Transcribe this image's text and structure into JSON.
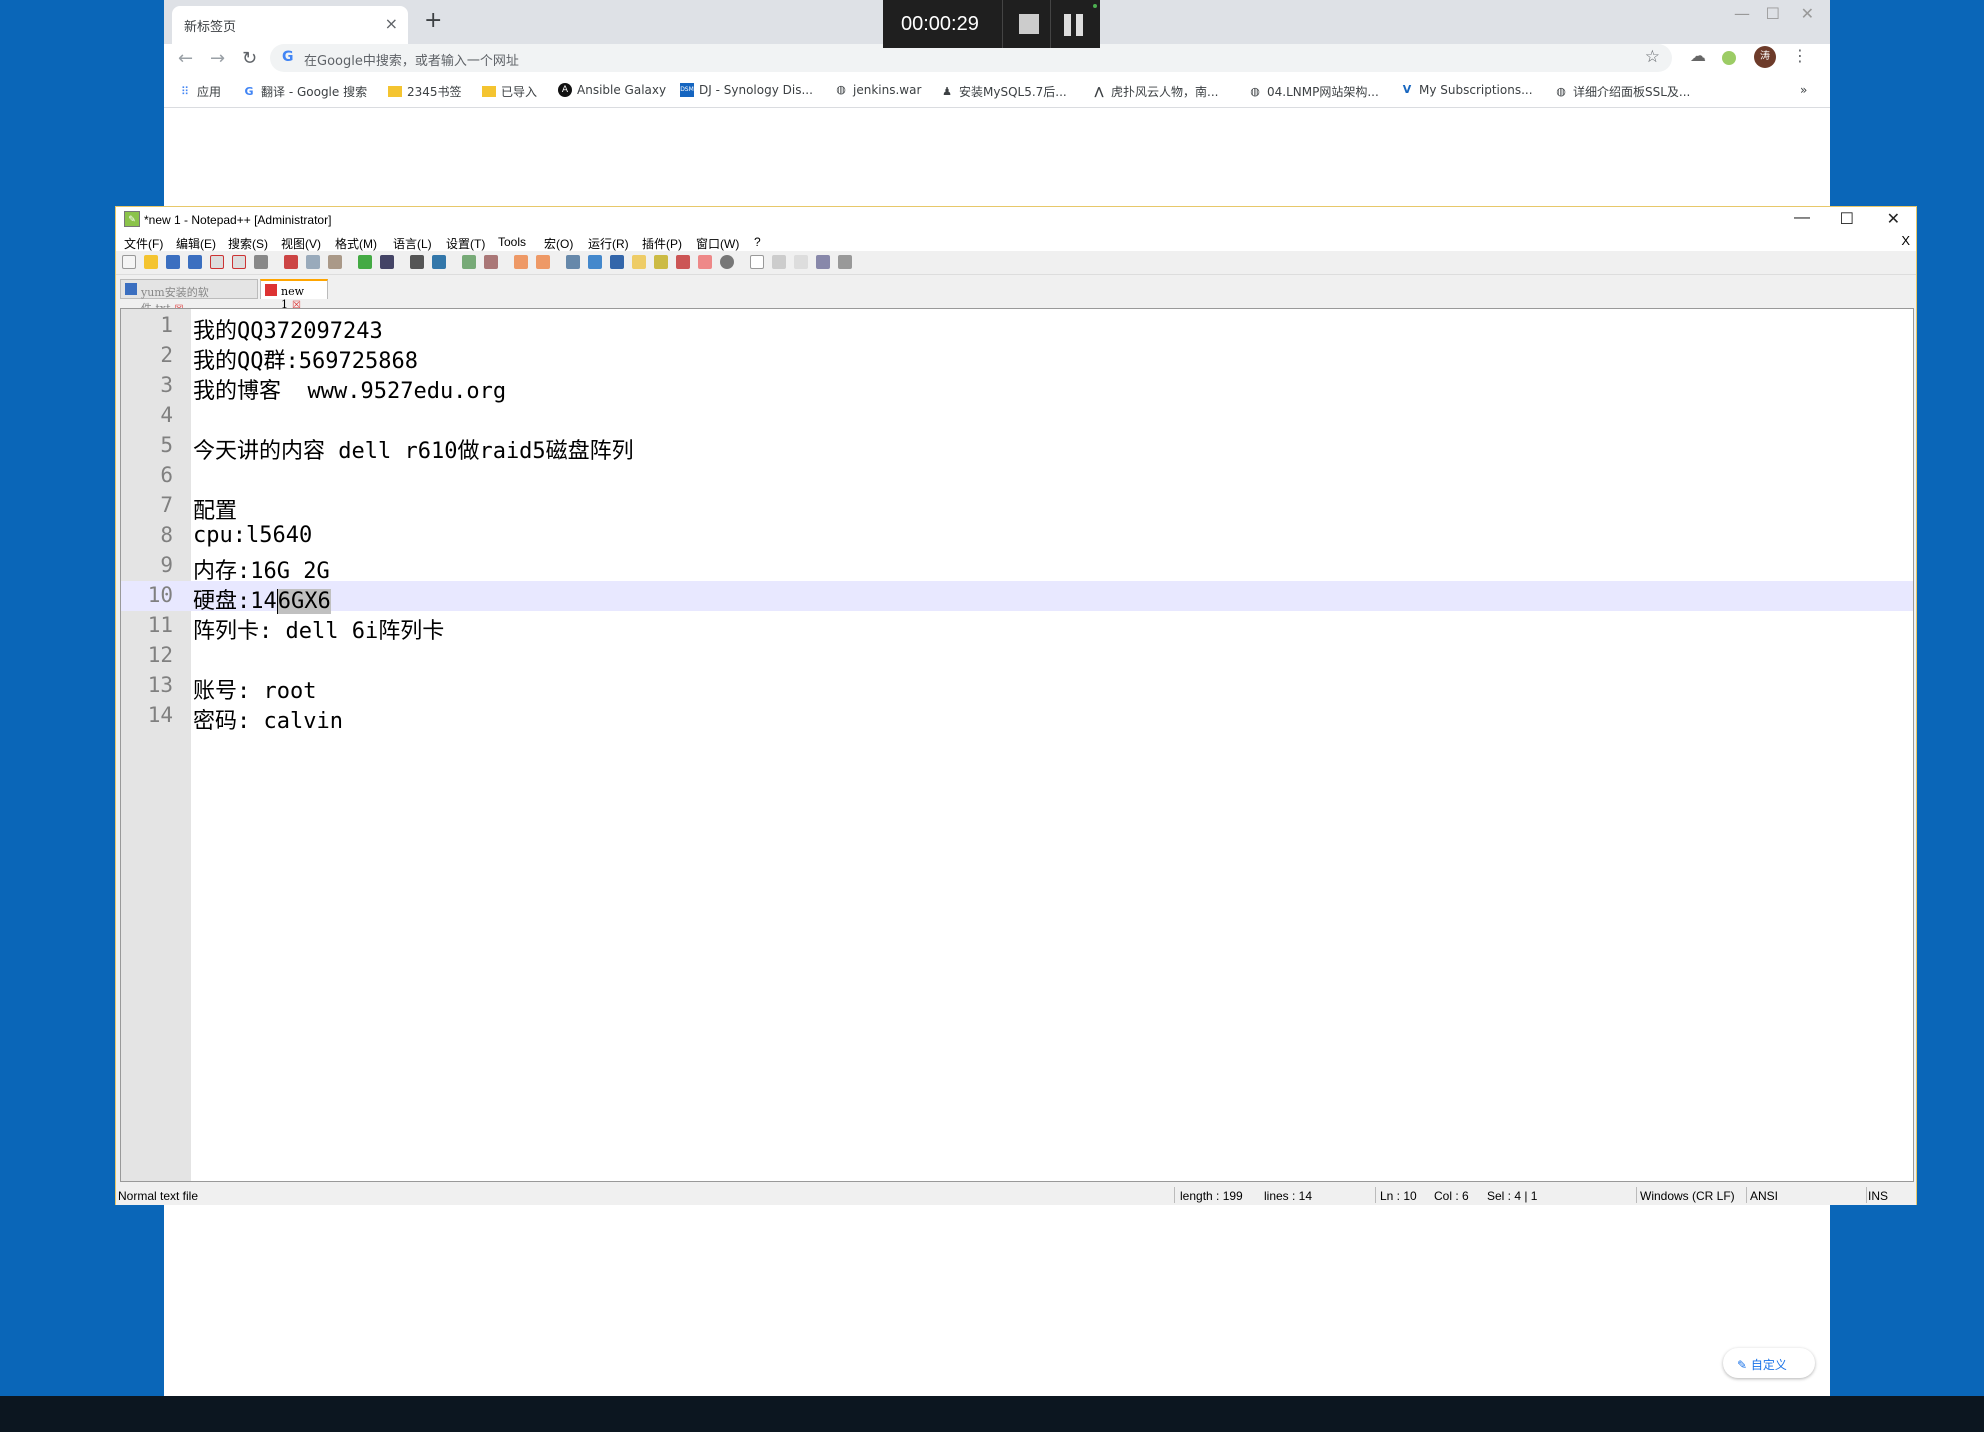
{
  "chrome": {
    "tab_title": "新标签页",
    "omnibox_placeholder": "在Google中搜索，或者输入一个网址",
    "avatar_initial": "涛",
    "bookmarks": [
      {
        "label": "应用",
        "icon": "apps-grid-icon"
      },
      {
        "label": "翻译 - Google 搜索",
        "icon": "google-icon"
      },
      {
        "label": "2345书签",
        "icon": "folder-icon"
      },
      {
        "label": "已导入",
        "icon": "folder-icon"
      },
      {
        "label": "Ansible Galaxy",
        "icon": "ansible-icon"
      },
      {
        "label": "DJ - Synology Dis...",
        "icon": "dsm-icon"
      },
      {
        "label": "jenkins.war",
        "icon": "globe-icon"
      },
      {
        "label": "安装MySQL5.7后...",
        "icon": "person-icon"
      },
      {
        "label": "虎扑风云人物，南...",
        "icon": "hupu-icon"
      },
      {
        "label": "04.LNMP网站架构...",
        "icon": "globe-icon"
      },
      {
        "label": "My Subscriptions...",
        "icon": "vuetify-icon"
      },
      {
        "label": "详细介绍面板SSL及...",
        "icon": "globe-icon"
      }
    ],
    "more_bookmarks": "»",
    "customize_label": "自定义"
  },
  "recorder": {
    "time": "00:00:29"
  },
  "npp": {
    "title": "*new 1 - Notepad++ [Administrator]",
    "menu": [
      "文件(F)",
      "编辑(E)",
      "搜索(S)",
      "视图(V)",
      "格式(M)",
      "语言(L)",
      "设置(T)",
      "Tools",
      "宏(O)",
      "运行(R)",
      "插件(P)",
      "窗口(W)",
      "?"
    ],
    "tabs": [
      {
        "label": "yum安装的软件.txt",
        "active": false
      },
      {
        "label": "new 1",
        "active": true
      }
    ],
    "lines": [
      "我的QQ372097243",
      "我的QQ群:569725868",
      "我的博客  www.9527edu.org",
      "",
      "今天讲的内容 dell r610做raid5磁盘阵列",
      "",
      "配置",
      "cpu:l5640",
      "内存:16G 2G",
      "硬盘:146GX6",
      "阵列卡: dell 6i阵列卡",
      "",
      "账号: root",
      "密码: calvin"
    ],
    "current_line": 10,
    "line10_parts": {
      "before": "硬盘:14",
      "selected": "6GX6"
    },
    "status": {
      "file_type": "Normal text file",
      "length": "length : 199",
      "lines": "lines : 14",
      "ln": "Ln : 10",
      "col": "Col : 6",
      "sel": "Sel : 4 | 1",
      "eol": "Windows (CR LF)",
      "encoding": "ANSI",
      "mode": "INS"
    }
  }
}
